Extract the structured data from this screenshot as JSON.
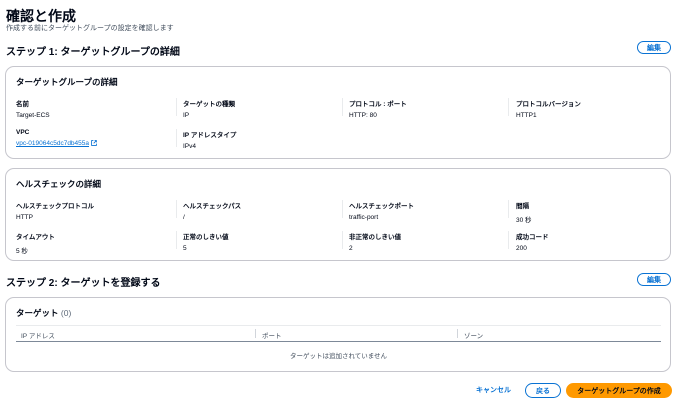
{
  "page": {
    "title": "確認と作成",
    "subtitle": "作成する前にターゲットグループの設定を確認します"
  },
  "step1": {
    "title": "ステップ 1: ターゲットグループの詳細",
    "edit_label": "編集",
    "target_group_card": {
      "heading": "ターゲットグループの詳細",
      "fields": {
        "name": {
          "label": "名前",
          "value": "Target-ECS"
        },
        "target_type": {
          "label": "ターゲットの種類",
          "value": "IP"
        },
        "protocol_port": {
          "label": "プロトコル : ポート",
          "value": "HTTP: 80"
        },
        "protocol_version": {
          "label": "プロトコルバージョン",
          "value": "HTTP1"
        },
        "vpc": {
          "label": "VPC",
          "value": "vpc-019064c5dc7db455a"
        },
        "ip_address_type": {
          "label": "IP アドレスタイプ",
          "value": "IPv4"
        }
      }
    },
    "health_check_card": {
      "heading": "ヘルスチェックの詳細",
      "fields": {
        "hc_protocol": {
          "label": "ヘルスチェックプロトコル",
          "value": "HTTP"
        },
        "hc_path": {
          "label": "ヘルスチェックパス",
          "value": "/"
        },
        "hc_port": {
          "label": "ヘルスチェックポート",
          "value": "traffic-port"
        },
        "interval": {
          "label": "間隔",
          "value": "30 秒"
        },
        "timeout": {
          "label": "タイムアウト",
          "value": "5 秒"
        },
        "healthy_threshold": {
          "label": "正常のしきい値",
          "value": "5"
        },
        "unhealthy_threshold": {
          "label": "非正常のしきい値",
          "value": "2"
        },
        "success_codes": {
          "label": "成功コード",
          "value": "200"
        }
      }
    }
  },
  "step2": {
    "title": "ステップ 2: ターゲットを登録する",
    "edit_label": "編集",
    "targets_card": {
      "heading": "ターゲット",
      "count": "(0)",
      "columns": [
        "IP アドレス",
        "ポート",
        "ゾーン"
      ],
      "empty_message": "ターゲットは追加されていません"
    }
  },
  "footer": {
    "cancel_label": "キャンセル",
    "back_label": "戻る",
    "create_label": "ターゲットグループの作成"
  },
  "colors": {
    "primary": "#0972d3",
    "create_button": "#ff9900",
    "border": "#c6c6cd"
  },
  "icons": {
    "vpc_link": "external-link-icon"
  }
}
